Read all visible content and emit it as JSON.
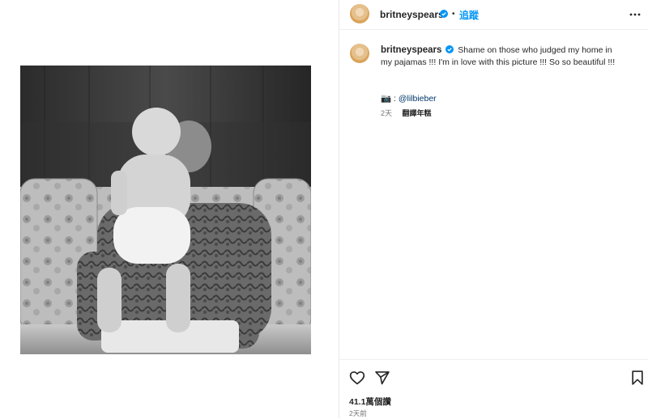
{
  "header": {
    "username": "britneyspears",
    "separator": "•",
    "follow_label": "追蹤",
    "more_icon": "more-horizontal-icon"
  },
  "caption": {
    "username": "britneyspears",
    "text": "Shame on those who judged my home in my pajamas !!! I'm in love with this picture !!! So so beautiful !!!",
    "credit_prefix": "📷 : ",
    "credit_handle": "@lilbieber",
    "age": "2天",
    "translate_label": "翻譯年糕"
  },
  "actions": {
    "like_icon": "heart-icon",
    "share_icon": "send-icon",
    "save_icon": "bookmark-icon",
    "likes": "41.1萬個讚",
    "timestamp": "2天前"
  },
  "colors": {
    "verified": "#0095f6",
    "follow": "#0095f6",
    "text": "#262626",
    "muted": "#737373"
  }
}
